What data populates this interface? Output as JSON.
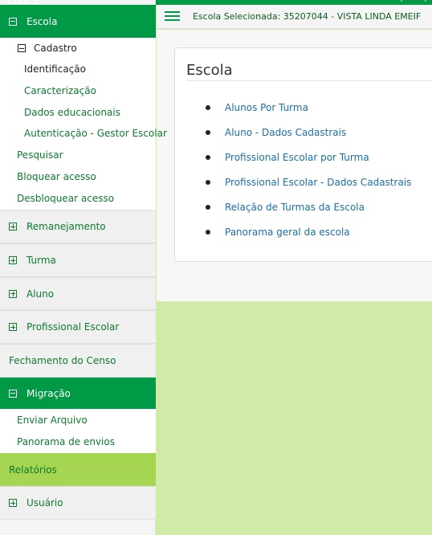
{
  "header": {
    "logo_text": "INEP",
    "top_right_fragment": "( ~ ~ )",
    "selected_school": "Escola Selecionada: 35207044 - VISTA LINDA EMEIF"
  },
  "sidebar": {
    "escola": {
      "label": "Escola",
      "cadastro": {
        "label": "Cadastro",
        "items": [
          "Identificação",
          "Caracterização",
          "Dados educacionais",
          "Autenticação - Gestor Escolar"
        ]
      },
      "links": [
        "Pesquisar",
        "Bloquear acesso",
        "Desbloquear acesso"
      ]
    },
    "remanejamento": "Remanejamento",
    "turma": "Turma",
    "aluno": "Aluno",
    "profissional": "Profissional Escolar",
    "fechamento": "Fechamento do Censo",
    "migracao": {
      "label": "Migração",
      "links": [
        "Enviar Arquivo",
        "Panorama de envios"
      ]
    },
    "relatorios": "Relatórios",
    "usuario": "Usuário"
  },
  "main": {
    "card_title": "Escola",
    "reports": [
      "Alunos Por Turma",
      "Aluno - Dados Cadastrais",
      "Profissional Escolar por Turma",
      "Profissional Escolar - Dados Cadastrais",
      "Relação de Turmas da Escola",
      "Panorama geral da escola"
    ]
  },
  "colors": {
    "brand_green": "#009945",
    "light_green": "#a6d651",
    "background_green": "#d0eaa7",
    "link_blue": "#1a6fa6"
  }
}
